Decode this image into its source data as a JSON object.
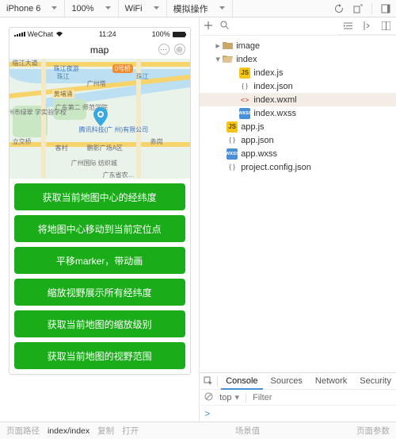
{
  "toolbar": {
    "device": "iPhone 6",
    "zoom": "100%",
    "network": "WiFi",
    "mock": "模拟操作"
  },
  "phone": {
    "carrier": "WeChat",
    "time": "11:24",
    "battery_pct": "100%",
    "title": "map"
  },
  "map_labels": {
    "l1": "临江大道",
    "l2": "珠江",
    "l3": "黄埔涌",
    "l4": "珠江夜游",
    "l5": "广州塔",
    "l6": "0号桥",
    "l7": "州市绿翠\n学实验学校",
    "l8": "广东第二\n师范学院",
    "l9": "腾讯科技(广\n州)有限公司",
    "l10": "客村",
    "l11": "鹏影广场A区",
    "l12": "广州国际\n纺织城",
    "l13": "赤岗",
    "l14": "立交桥",
    "l15": "广东省农…"
  },
  "buttons": {
    "b1": "获取当前地图中心的经纬度",
    "b2": "将地图中心移动到当前定位点",
    "b3": "平移marker，带动画",
    "b4": "缩放视野展示所有经纬度",
    "b5": "获取当前地图的缩放级别",
    "b6": "获取当前地图的视野范围"
  },
  "tree": {
    "image": "image",
    "index": "index",
    "index_js": "index.js",
    "index_json": "index.json",
    "index_wxml": "index.wxml",
    "index_wxss": "index.wxss",
    "app_js": "app.js",
    "app_json": "app.json",
    "app_wxss": "app.wxss",
    "proj": "project.config.json"
  },
  "console": {
    "tab_console": "Console",
    "tab_sources": "Sources",
    "tab_network": "Network",
    "tab_security": "Security",
    "scope": "top",
    "filter_ph": "Filter",
    "prompt": ">"
  },
  "footer": {
    "path_label": "页面路径",
    "path_value": "index/index",
    "copy": "复制",
    "open": "打开",
    "scene": "场景值",
    "params": "页面参数"
  }
}
